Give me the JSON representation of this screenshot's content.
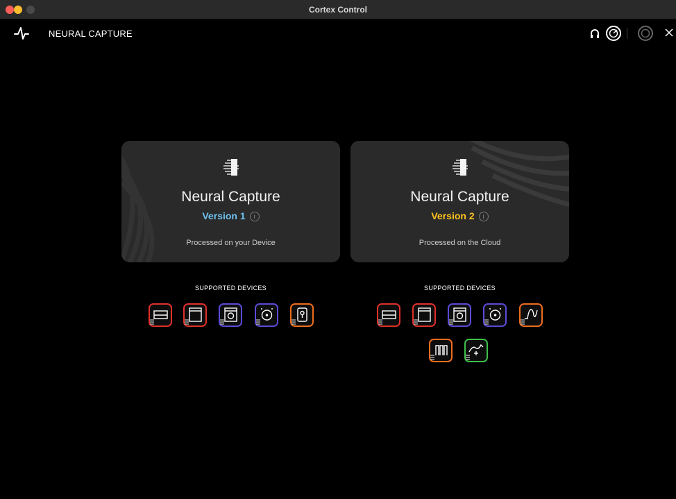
{
  "window": {
    "title": "Cortex Control"
  },
  "header": {
    "title": "NEURAL CAPTURE",
    "icons": [
      "waveform-logo-icon",
      "headphones-icon",
      "device-knob-icon",
      "device-knob-dim-icon",
      "close-icon"
    ]
  },
  "colors": {
    "version1": "#6fc1f0",
    "version2": "#ffc21f",
    "card_bg": "#2a2a2a",
    "red": "#e0302a",
    "purple": "#5b4ad8",
    "orange": "#ee6d1c",
    "green": "#3fbf4a"
  },
  "cards": [
    {
      "title": "Neural Capture",
      "version": "Version 1",
      "subtitle": "Processed on your Device",
      "supported_label": "SUPPORTED DEVICES",
      "devices": [
        "amp-icon",
        "cab-icon",
        "speaker-cab-icon",
        "speaker-icon",
        "pedal-icon"
      ]
    },
    {
      "title": "Neural Capture",
      "version": "Version 2",
      "subtitle": "Processed on the Cloud",
      "supported_label": "SUPPORTED DEVICES",
      "devices": [
        "amp-icon",
        "cab-icon",
        "speaker-cab-icon",
        "speaker-icon",
        "waveform-icon",
        "eq-icon",
        "modulation-icon"
      ]
    }
  ]
}
